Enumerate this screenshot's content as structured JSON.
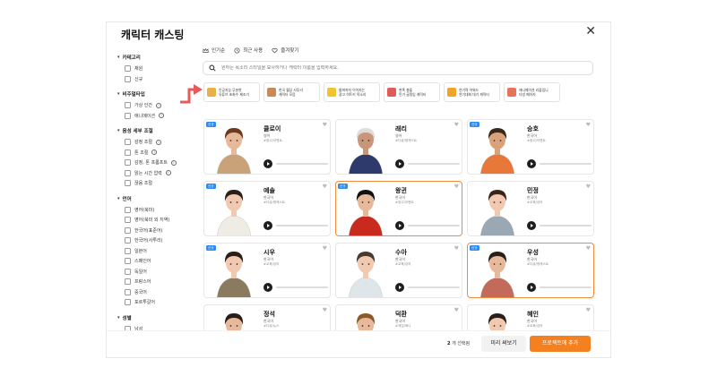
{
  "modal": {
    "title": "캐릭터 캐스팅",
    "close_glyph": "✕"
  },
  "sort": {
    "popular": "인기순",
    "recent": "최근 사용",
    "favorites": "즐겨찾기"
  },
  "search": {
    "placeholder": "원하는 목소리 스타일을 묘사하거나 캐릭터 이름을 입력하세요."
  },
  "filters": {
    "category": {
      "title": "카테고리",
      "options": [
        "채원",
        "신규"
      ]
    },
    "visual": {
      "title": "비주얼타입",
      "options": [
        "가상 인간",
        "애니메이션"
      ]
    },
    "voice": {
      "title": "음성 세부 조절",
      "options": [
        "감정 조절",
        "톤 조절",
        "감정, 톤 프롬프트",
        "읽는 시간 압력",
        "끊음 조절"
      ]
    },
    "language": {
      "title": "언어",
      "options": [
        "영어(북미)",
        "영어(북미 외 지역)",
        "한국어(표준어)",
        "한국어(사투리)",
        "일본어",
        "스페인어",
        "독일어",
        "프랑스어",
        "중국어",
        "포르투갈어"
      ]
    },
    "gender": {
      "title": "성별",
      "options": [
        "남성"
      ]
    }
  },
  "categories": [
    {
      "label": "인공지능 무분한\n유튜브 초회수 제조기",
      "icon_color": "#e8b04a"
    },
    {
      "label": "한국 월당 사투리\n캐릭터 모음",
      "icon_color": "#c98a5a"
    },
    {
      "label": "할퍼까지 이어지는\n광고 히트키 목소리",
      "icon_color": "#f2c230"
    },
    {
      "label": "현혹 충돌\n민기 글쟁임 캐릭터",
      "icon_color": "#e05a5a"
    },
    {
      "label": "연기력 어워드\n연기대회 대기 캐릭터",
      "icon_color": "#f0a52a"
    },
    {
      "label": "애니메이션 리플입니\n더빙 페어지",
      "icon_color": "#e8735a"
    }
  ],
  "characters": [
    {
      "name": "클로이",
      "lang": "영어",
      "tags": "#광고/이벤트",
      "is_new": true,
      "selected": false,
      "skin": "#e8b89a",
      "hair": "#6b3a1e",
      "shirt": "#c9a27a"
    },
    {
      "name": "래리",
      "lang": "영어",
      "tags": "#다큐/명캐스트",
      "is_new": false,
      "selected": false,
      "skin": "#c9967a",
      "hair": "#dcdcdc",
      "shirt": "#2d3a6b"
    },
    {
      "name": "승호",
      "lang": "한국어",
      "tags": "#광고/이벤트",
      "is_new": true,
      "selected": false,
      "skin": "#d9a27a",
      "hair": "#3a2a1e",
      "shirt": "#e8773a"
    },
    {
      "name": "예솔",
      "lang": "한국어",
      "tags": "#다큐/명캐스트",
      "is_new": true,
      "selected": false,
      "skin": "#f0c9b0",
      "hair": "#2a1e18",
      "shirt": "#efece6"
    },
    {
      "name": "왕귄",
      "lang": "한국어",
      "tags": "#광고/이벤트",
      "is_new": true,
      "selected": true,
      "skin": "#e8b89a",
      "hair": "#111111",
      "shirt": "#c82a1e"
    },
    {
      "name": "민정",
      "lang": "한국어",
      "tags": "#교육/강의",
      "is_new": false,
      "selected": false,
      "skin": "#f0c9b0",
      "hair": "#3a2418",
      "shirt": "#9aa8b4"
    },
    {
      "name": "시우",
      "lang": "한국어",
      "tags": "#교육/강의",
      "is_new": true,
      "selected": false,
      "skin": "#f0c9b0",
      "hair": "#2a1e18",
      "shirt": "#8a7a5e"
    },
    {
      "name": "수아",
      "lang": "한국어",
      "tags": "#교육/강의",
      "is_new": false,
      "selected": false,
      "skin": "#f0c9b0",
      "hair": "#4a3a2e",
      "shirt": "#dfe6ea"
    },
    {
      "name": "우성",
      "lang": "한국어",
      "tags": "#다큐/명캐스트",
      "is_new": true,
      "selected": true,
      "skin": "#e8b89a",
      "hair": "#2a1e18",
      "shirt": "#c46a5a"
    },
    {
      "name": "정석",
      "lang": "한국어",
      "tags": "#다큐/뉴스",
      "is_new": false,
      "selected": false,
      "skin": "#e8b89a",
      "hair": "#2a1e18",
      "shirt": "#ffffff"
    },
    {
      "name": "덕환",
      "lang": "한국어",
      "tags": "#게임/애니",
      "is_new": false,
      "selected": false,
      "skin": "#e8b89a",
      "hair": "#8a5a2a",
      "shirt": "#f2c230"
    },
    {
      "name": "혜인",
      "lang": "한국어",
      "tags": "#교육/강의",
      "is_new": false,
      "selected": false,
      "skin": "#f0c9b0",
      "hair": "#2a1e18",
      "shirt": "#ffffff"
    }
  ],
  "footer": {
    "count": "2",
    "count_suffix": "개 선택됨",
    "preview_label": "미리 써보기",
    "add_label": "프로젝트에 추가"
  },
  "colors": {
    "accent": "#f5801f",
    "new_badge": "#2e8bf0",
    "arrow": "#e85a5a"
  }
}
